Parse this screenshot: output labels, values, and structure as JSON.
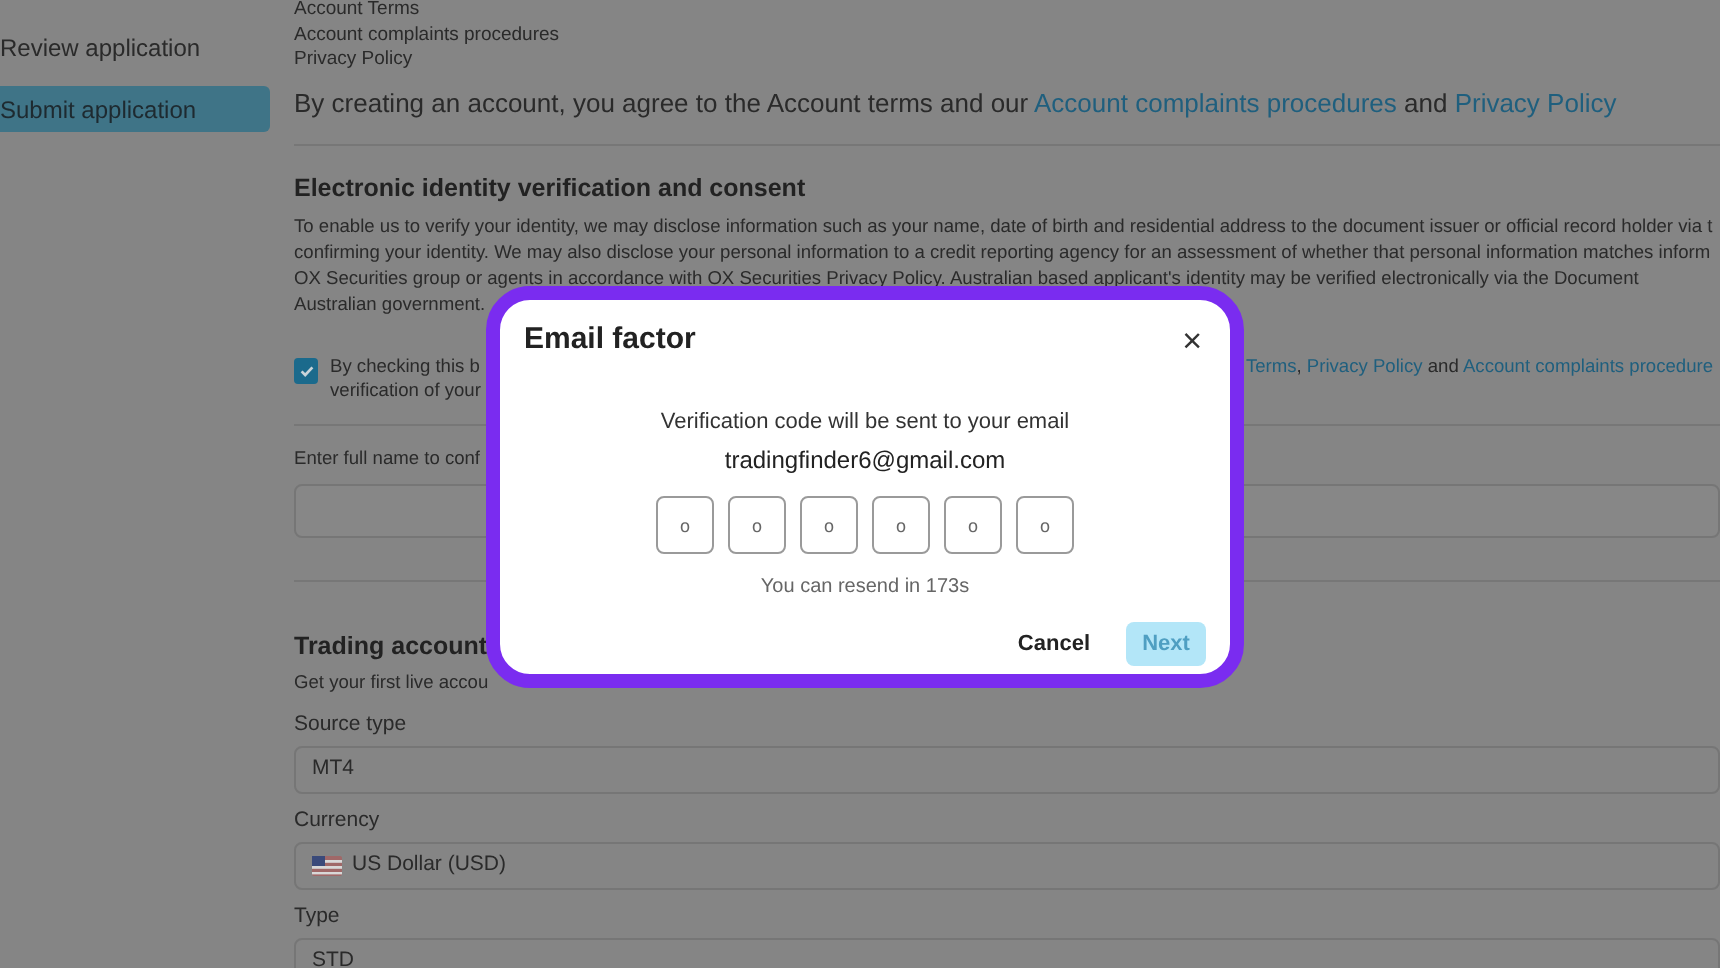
{
  "sidebar": {
    "items": [
      {
        "label": "Review application",
        "selected": false
      },
      {
        "label": "Submit application",
        "selected": true
      }
    ]
  },
  "documents": [
    "Account Terms",
    "Account complaints procedures",
    "Privacy Policy"
  ],
  "agreement": [
    {
      "text": "By creating an account, you agree to the Account terms and our ",
      "link": false
    },
    {
      "text": "Account complaints procedures",
      "link": true
    },
    {
      "text": " and ",
      "link": false
    },
    {
      "text": "Privacy Policy",
      "link": true
    }
  ],
  "consent": {
    "heading": "Electronic identity verification and consent",
    "paragraph_lines": [
      "To enable us to verify your identity, we may disclose information such as your name, date of birth and residential address to the document issuer or official record holder via t",
      "confirming your identity. We may also disclose your personal information to a credit reporting agency for an assessment of whether that personal information matches inform",
      "OX Securities group or agents in accordance with OX Securities Privacy Policy. Australian based applicant's identity may be verified electronically via the Document",
      "Australian government."
    ],
    "checkbox": {
      "checked": true,
      "line_1_start": "By checking this b",
      "line_2_start": "verification of your",
      "line_1_end": [
        {
          "text": "Terms",
          "link": true
        },
        {
          "text": ", ",
          "link": false
        },
        {
          "text": "Privacy Policy",
          "link": true
        },
        {
          "text": " and ",
          "link": false
        },
        {
          "text": "Account complaints procedure",
          "link": true
        }
      ]
    },
    "name_label": "Enter full name to conf"
  },
  "trading_account": {
    "heading": "Trading account",
    "subtitle": "Get your first live accou",
    "fields": [
      {
        "kind": "select",
        "label": "Source type",
        "value": "MT4"
      },
      {
        "kind": "currency",
        "label": "Currency",
        "value": "US Dollar (USD)"
      },
      {
        "kind": "select",
        "label": "Type",
        "value": "STD"
      }
    ]
  },
  "dialog": {
    "title": "Email factor",
    "close": "×",
    "message": "Verification code will be sent to your email",
    "email": "tradingfinder6@gmail.com",
    "code_boxes": [
      {
        "placeholder": "o"
      },
      {
        "placeholder": "o"
      },
      {
        "placeholder": "o"
      },
      {
        "placeholder": "o"
      },
      {
        "placeholder": "o"
      },
      {
        "placeholder": "o"
      }
    ],
    "resend": "You can resend in 173s",
    "cancel": "Cancel",
    "next": "Next",
    "next_disabled": true
  }
}
